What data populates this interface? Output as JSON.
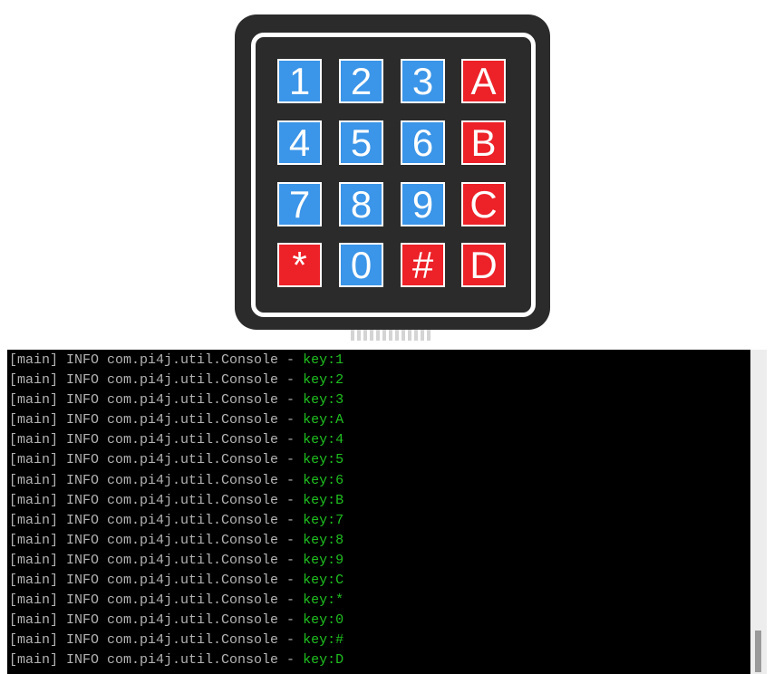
{
  "keypad": {
    "rows": [
      [
        {
          "label": "1",
          "color": "#3b95e8",
          "name": "key-1"
        },
        {
          "label": "2",
          "color": "#3b95e8",
          "name": "key-2"
        },
        {
          "label": "3",
          "color": "#3b95e8",
          "name": "key-3"
        },
        {
          "label": "A",
          "color": "#ed2128",
          "name": "key-a"
        }
      ],
      [
        {
          "label": "4",
          "color": "#3b95e8",
          "name": "key-4"
        },
        {
          "label": "5",
          "color": "#3b95e8",
          "name": "key-5"
        },
        {
          "label": "6",
          "color": "#3b95e8",
          "name": "key-6"
        },
        {
          "label": "B",
          "color": "#ed2128",
          "name": "key-b"
        }
      ],
      [
        {
          "label": "7",
          "color": "#3b95e8",
          "name": "key-7"
        },
        {
          "label": "8",
          "color": "#3b95e8",
          "name": "key-8"
        },
        {
          "label": "9",
          "color": "#3b95e8",
          "name": "key-9"
        },
        {
          "label": "C",
          "color": "#ed2128",
          "name": "key-c"
        }
      ],
      [
        {
          "label": "*",
          "color": "#ed2128",
          "name": "key-star"
        },
        {
          "label": "0",
          "color": "#3b95e8",
          "name": "key-0"
        },
        {
          "label": "#",
          "color": "#ed2128",
          "name": "key-hash"
        },
        {
          "label": "D",
          "color": "#ed2128",
          "name": "key-d"
        }
      ]
    ]
  },
  "terminal": {
    "lines": [
      {
        "prefix": "[main] INFO com.pi4j.util.Console - ",
        "key": "key:1"
      },
      {
        "prefix": "[main] INFO com.pi4j.util.Console - ",
        "key": "key:2"
      },
      {
        "prefix": "[main] INFO com.pi4j.util.Console - ",
        "key": "key:3"
      },
      {
        "prefix": "[main] INFO com.pi4j.util.Console - ",
        "key": "key:A"
      },
      {
        "prefix": "[main] INFO com.pi4j.util.Console - ",
        "key": "key:4"
      },
      {
        "prefix": "[main] INFO com.pi4j.util.Console - ",
        "key": "key:5"
      },
      {
        "prefix": "[main] INFO com.pi4j.util.Console - ",
        "key": "key:6"
      },
      {
        "prefix": "[main] INFO com.pi4j.util.Console - ",
        "key": "key:B"
      },
      {
        "prefix": "[main] INFO com.pi4j.util.Console - ",
        "key": "key:7"
      },
      {
        "prefix": "[main] INFO com.pi4j.util.Console - ",
        "key": "key:8"
      },
      {
        "prefix": "[main] INFO com.pi4j.util.Console - ",
        "key": "key:9"
      },
      {
        "prefix": "[main] INFO com.pi4j.util.Console - ",
        "key": "key:C"
      },
      {
        "prefix": "[main] INFO com.pi4j.util.Console - ",
        "key": "key:*"
      },
      {
        "prefix": "[main] INFO com.pi4j.util.Console - ",
        "key": "key:0"
      },
      {
        "prefix": "[main] INFO com.pi4j.util.Console - ",
        "key": "key:#"
      },
      {
        "prefix": "[main] INFO com.pi4j.util.Console - ",
        "key": "key:D"
      }
    ],
    "colors": {
      "background": "#000000",
      "prefix_text": "#b3b3b3",
      "key_text": "#1fc01f"
    }
  }
}
